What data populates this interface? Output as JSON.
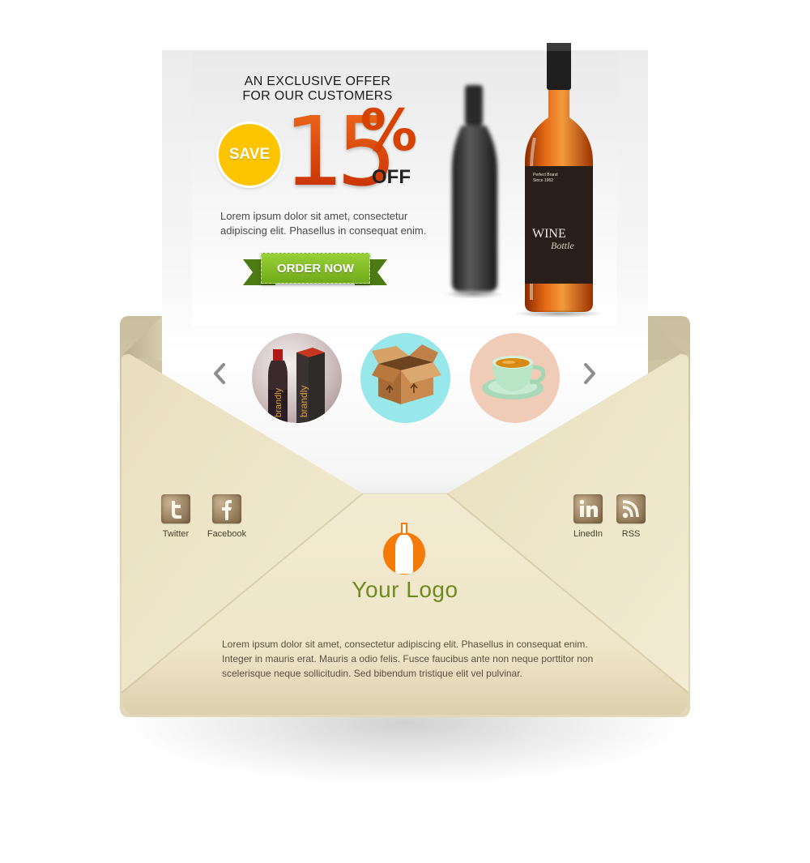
{
  "offer": {
    "headline_line1": "AN EXCLUSIVE OFFER",
    "headline_line2": "FOR OUR CUSTOMERS",
    "badge_label": "SAVE",
    "discount_number": "15",
    "discount_symbol": "%",
    "discount_suffix": "OFF",
    "body_line1": "Lorem ipsum dolor sit amet, consectetur",
    "body_line2": "adipiscing elit. Phasellus in consequat enim.",
    "button_label": "ORDER NOW"
  },
  "product": {
    "label_small_line1": "Perfect Brand",
    "label_small_line2": "Since 1962",
    "label_title": "WINE",
    "label_script": "Bottle",
    "box_text": "brandly"
  },
  "carousel": {
    "items": [
      {
        "icon": "wine-box-icon"
      },
      {
        "icon": "cardboard-box-icon"
      },
      {
        "icon": "tea-cup-icon"
      }
    ]
  },
  "social": {
    "left": [
      {
        "label": "Twitter",
        "icon": "twitter-icon"
      },
      {
        "label": "Facebook",
        "icon": "facebook-icon"
      }
    ],
    "right": [
      {
        "label": "LinedIn",
        "icon": "linkedin-icon"
      },
      {
        "label": "RSS",
        "icon": "rss-icon"
      }
    ]
  },
  "logo": {
    "text": "Your Logo"
  },
  "footer": {
    "line1": "Lorem ipsum dolor sit amet, consectetur adipiscing elit. Phasellus in consequat enim.",
    "line2": "Integer in mauris erat. Mauris a odio felis. Fusce faucibus ante non neque porttitor non",
    "line3": "scelerisque neque sollicitudin. Sed bibendum tristique elit vel pulvinar."
  },
  "colors": {
    "accent_orange": "#d23e00",
    "save_badge": "#fdc400",
    "button_green": "#7ab51d",
    "logo_green": "#6f8a1e",
    "envelope": "#efe6c9"
  }
}
